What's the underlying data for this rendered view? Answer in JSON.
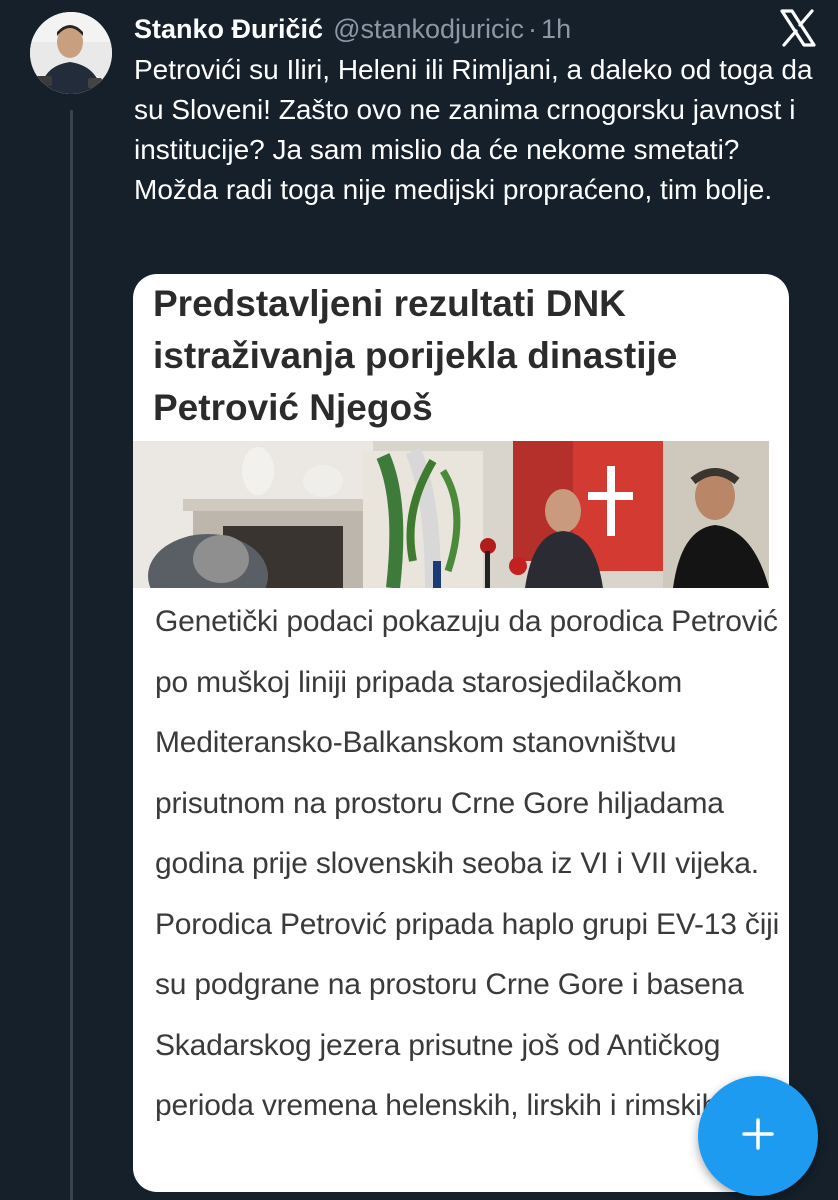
{
  "tweet": {
    "author_name": "Stanko Đuričić",
    "handle": "@stankodjuricic",
    "separator": "·",
    "time": "1h",
    "text": "Petrovići su Iliri, Heleni ili Rimljani, a daleko od toga da su Sloveni! Zašto ovo ne zanima crnogorsku javnost i institucije? Ja sam mislio da će nekome smetati? Možda radi toga nije medijski propraćeno, tim bolje."
  },
  "card": {
    "title": "Predstavljeni rezultati DNK istraživanja porijekla dinastije Petrović Njegoš",
    "body": "Genetički podaci pokazuju da porodica Petrović po muškoj liniji pripada starosjedilačkom Mediteransko-Balkanskom stanovništvu prisutnom na prostoru Crne Gore hiljadama godina prije slovenskih seoba iz VI i VII vijeka. Porodica Petrović pripada haplo grupi EV-13 čiji su podgrane na prostoru Crne Gore i basena Skadarskog jezera prisutne još od Antičkog perioda vremena helenskih, lirskih i rimskih utic"
  },
  "icons": {
    "brand": "x-logo-icon",
    "compose": "plus-icon"
  },
  "colors": {
    "background": "#15202b",
    "text_primary": "#ffffff",
    "text_secondary": "#8b98a5",
    "accent": "#1d9bf0",
    "card_background": "#ffffff"
  }
}
